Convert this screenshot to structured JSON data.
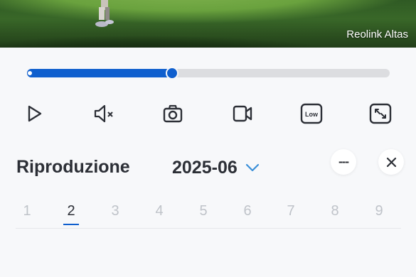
{
  "video": {
    "camera_name": "Reolink Altas"
  },
  "playback": {
    "progress": 0.4
  },
  "toolbar": {
    "icons": [
      "play-icon",
      "mute-icon",
      "snapshot-icon",
      "record-icon",
      "quality-low-icon",
      "fullscreen-icon"
    ],
    "quality_label": "Low"
  },
  "header": {
    "title": "Riproduzione",
    "month": "2025-06",
    "more_label": "---"
  },
  "days": {
    "items": [
      "1",
      "2",
      "3",
      "4",
      "5",
      "6",
      "7",
      "8",
      "9"
    ],
    "selected": "2"
  },
  "colors": {
    "accent": "#0f5fce",
    "text": "#2c2f36",
    "muted": "#bfc3c9",
    "chevron": "#3a8fd8"
  }
}
